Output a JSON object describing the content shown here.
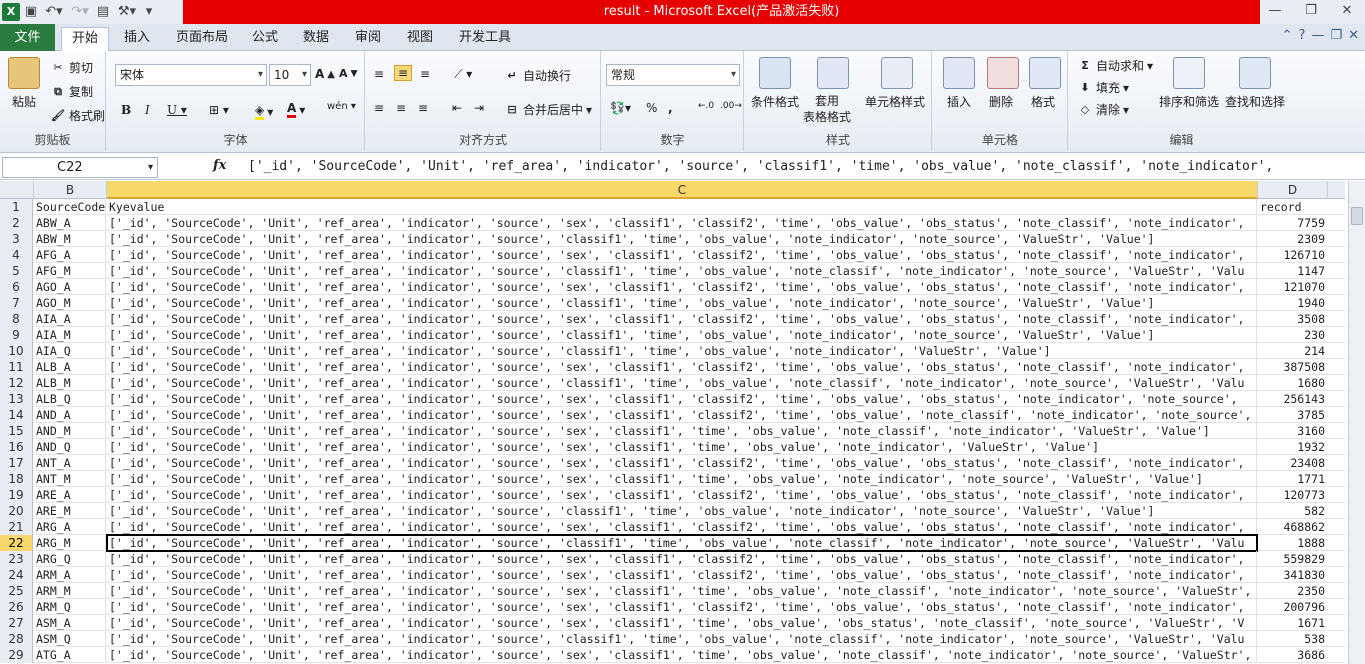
{
  "window": {
    "title": "result - Microsoft Excel(产品激活失败)"
  },
  "tabs": [
    "文件",
    "开始",
    "插入",
    "页面布局",
    "公式",
    "数据",
    "审阅",
    "视图",
    "开发工具"
  ],
  "ribbon": {
    "clipboard": {
      "label": "剪贴板",
      "paste": "粘贴",
      "cut": "剪切",
      "copy": "复制",
      "painter": "格式刷"
    },
    "font": {
      "label": "字体",
      "name": "宋体",
      "size": "10"
    },
    "align": {
      "label": "对齐方式",
      "wrap": "自动换行",
      "merge": "合并后居中"
    },
    "number": {
      "label": "数字",
      "format": "常规"
    },
    "styles": {
      "label": "样式",
      "cond": "条件格式",
      "table": "套用\n表格格式",
      "cell": "单元格样式"
    },
    "cells": {
      "label": "单元格",
      "insert": "插入",
      "delete": "删除",
      "format": "格式"
    },
    "edit": {
      "label": "编辑",
      "autosum": "自动求和",
      "fill": "填充",
      "clear": "清除",
      "sort": "排序和筛选",
      "find": "查找和选择"
    }
  },
  "formula_bar": {
    "name_box": "C22",
    "fx": "fx",
    "content": "['_id', 'SourceCode', 'Unit', 'ref_area', 'indicator', 'source', 'classif1', 'time', 'obs_value', 'note_classif', 'note_indicator',"
  },
  "columns": [
    "B",
    "C",
    "D"
  ],
  "rows": [
    {
      "n": "1",
      "b": "SourceCode",
      "c": "Kyevalue",
      "d": "record",
      "num": false
    },
    {
      "n": "2",
      "b": "ABW_A",
      "c": "['_id', 'SourceCode', 'Unit', 'ref_area', 'indicator', 'source', 'sex', 'classif1', 'classif2', 'time', 'obs_value', 'obs_status', 'note_classif', 'note_indicator',",
      "d": "7759"
    },
    {
      "n": "3",
      "b": "ABW_M",
      "c": "['_id', 'SourceCode', 'Unit', 'ref_area', 'indicator', 'source', 'classif1', 'time', 'obs_value', 'note_indicator', 'note_source', 'ValueStr', 'Value']",
      "d": "2309"
    },
    {
      "n": "4",
      "b": "AFG_A",
      "c": "['_id', 'SourceCode', 'Unit', 'ref_area', 'indicator', 'source', 'sex', 'classif1', 'classif2', 'time', 'obs_value', 'obs_status', 'note_classif', 'note_indicator',",
      "d": "126710"
    },
    {
      "n": "5",
      "b": "AFG_M",
      "c": "['_id', 'SourceCode', 'Unit', 'ref_area', 'indicator', 'source', 'classif1', 'time', 'obs_value', 'note_classif', 'note_indicator', 'note_source', 'ValueStr', 'Valu",
      "d": "1147"
    },
    {
      "n": "6",
      "b": "AGO_A",
      "c": "['_id', 'SourceCode', 'Unit', 'ref_area', 'indicator', 'source', 'sex', 'classif1', 'classif2', 'time', 'obs_value', 'obs_status', 'note_classif', 'note_indicator',",
      "d": "121070"
    },
    {
      "n": "7",
      "b": "AGO_M",
      "c": "['_id', 'SourceCode', 'Unit', 'ref_area', 'indicator', 'source', 'classif1', 'time', 'obs_value', 'note_indicator', 'note_source', 'ValueStr', 'Value']",
      "d": "1940"
    },
    {
      "n": "8",
      "b": "AIA_A",
      "c": "['_id', 'SourceCode', 'Unit', 'ref_area', 'indicator', 'source', 'sex', 'classif1', 'classif2', 'time', 'obs_value', 'obs_status', 'note_classif', 'note_indicator',",
      "d": "3508"
    },
    {
      "n": "9",
      "b": "AIA_M",
      "c": "['_id', 'SourceCode', 'Unit', 'ref_area', 'indicator', 'source', 'classif1', 'time', 'obs_value', 'note_indicator', 'note_source', 'ValueStr', 'Value']",
      "d": "230"
    },
    {
      "n": "10",
      "b": "AIA_Q",
      "c": "['_id', 'SourceCode', 'Unit', 'ref_area', 'indicator', 'source', 'classif1', 'time', 'obs_value', 'note_indicator', 'ValueStr', 'Value']",
      "d": "214"
    },
    {
      "n": "11",
      "b": "ALB_A",
      "c": "['_id', 'SourceCode', 'Unit', 'ref_area', 'indicator', 'source', 'sex', 'classif1', 'classif2', 'time', 'obs_value', 'obs_status', 'note_classif', 'note_indicator',",
      "d": "387508"
    },
    {
      "n": "12",
      "b": "ALB_M",
      "c": "['_id', 'SourceCode', 'Unit', 'ref_area', 'indicator', 'source', 'classif1', 'time', 'obs_value', 'note_classif', 'note_indicator', 'note_source', 'ValueStr', 'Valu",
      "d": "1680"
    },
    {
      "n": "13",
      "b": "ALB_Q",
      "c": "['_id', 'SourceCode', 'Unit', 'ref_area', 'indicator', 'source', 'sex', 'classif1', 'classif2', 'time', 'obs_value', 'obs_status', 'note_indicator', 'note_source',",
      "d": "256143"
    },
    {
      "n": "14",
      "b": "AND_A",
      "c": "['_id', 'SourceCode', 'Unit', 'ref_area', 'indicator', 'source', 'sex', 'classif1', 'classif2', 'time', 'obs_value', 'note_classif', 'note_indicator', 'note_source',",
      "d": "3785"
    },
    {
      "n": "15",
      "b": "AND_M",
      "c": "['_id', 'SourceCode', 'Unit', 'ref_area', 'indicator', 'source', 'sex', 'classif1', 'time', 'obs_value', 'note_classif', 'note_indicator', 'ValueStr', 'Value']",
      "d": "3160"
    },
    {
      "n": "16",
      "b": "AND_Q",
      "c": "['_id', 'SourceCode', 'Unit', 'ref_area', 'indicator', 'source', 'sex', 'classif1', 'time', 'obs_value', 'note_indicator', 'ValueStr', 'Value']",
      "d": "1932"
    },
    {
      "n": "17",
      "b": "ANT_A",
      "c": "['_id', 'SourceCode', 'Unit', 'ref_area', 'indicator', 'source', 'sex', 'classif1', 'classif2', 'time', 'obs_value', 'obs_status', 'note_classif', 'note_indicator',",
      "d": "23408"
    },
    {
      "n": "18",
      "b": "ANT_M",
      "c": "['_id', 'SourceCode', 'Unit', 'ref_area', 'indicator', 'source', 'sex', 'classif1', 'time', 'obs_value', 'note_indicator', 'note_source', 'ValueStr', 'Value']",
      "d": "1771"
    },
    {
      "n": "19",
      "b": "ARE_A",
      "c": "['_id', 'SourceCode', 'Unit', 'ref_area', 'indicator', 'source', 'sex', 'classif1', 'classif2', 'time', 'obs_value', 'obs_status', 'note_classif', 'note_indicator',",
      "d": "120773"
    },
    {
      "n": "20",
      "b": "ARE_M",
      "c": "['_id', 'SourceCode', 'Unit', 'ref_area', 'indicator', 'source', 'classif1', 'time', 'obs_value', 'note_indicator', 'note_source', 'ValueStr', 'Value']",
      "d": "582"
    },
    {
      "n": "21",
      "b": "ARG_A",
      "c": "['_id', 'SourceCode', 'Unit', 'ref_area', 'indicator', 'source', 'sex', 'classif1', 'classif2', 'time', 'obs_value', 'obs_status', 'note_classif', 'note_indicator',",
      "d": "468862"
    },
    {
      "n": "22",
      "b": "ARG_M",
      "c": "['_id', 'SourceCode', 'Unit', 'ref_area', 'indicator', 'source', 'classif1', 'time', 'obs_value', 'note_classif', 'note_indicator', 'note_source', 'ValueStr', 'Valu",
      "d": "1888",
      "selected": true
    },
    {
      "n": "23",
      "b": "ARG_Q",
      "c": "['_id', 'SourceCode', 'Unit', 'ref_area', 'indicator', 'source', 'sex', 'classif1', 'classif2', 'time', 'obs_value', 'obs_status', 'note_classif', 'note_indicator',",
      "d": "559829"
    },
    {
      "n": "24",
      "b": "ARM_A",
      "c": "['_id', 'SourceCode', 'Unit', 'ref_area', 'indicator', 'source', 'sex', 'classif1', 'classif2', 'time', 'obs_value', 'obs_status', 'note_classif', 'note_indicator',",
      "d": "341830"
    },
    {
      "n": "25",
      "b": "ARM_M",
      "c": "['_id', 'SourceCode', 'Unit', 'ref_area', 'indicator', 'source', 'sex', 'classif1', 'time', 'obs_value', 'note_classif', 'note_indicator', 'note_source', 'ValueStr',",
      "d": "2350"
    },
    {
      "n": "26",
      "b": "ARM_Q",
      "c": "['_id', 'SourceCode', 'Unit', 'ref_area', 'indicator', 'source', 'sex', 'classif1', 'classif2', 'time', 'obs_value', 'obs_status', 'note_classif', 'note_indicator',",
      "d": "200796"
    },
    {
      "n": "27",
      "b": "ASM_A",
      "c": "['_id', 'SourceCode', 'Unit', 'ref_area', 'indicator', 'source', 'sex', 'classif1', 'time', 'obs_value', 'obs_status', 'note_classif', 'note_source', 'ValueStr', 'V",
      "d": "1671"
    },
    {
      "n": "28",
      "b": "ASM_Q",
      "c": "['_id', 'SourceCode', 'Unit', 'ref_area', 'indicator', 'source', 'classif1', 'time', 'obs_value', 'note_classif', 'note_indicator', 'note_source', 'ValueStr', 'Valu",
      "d": "538"
    },
    {
      "n": "29",
      "b": "ATG_A",
      "c": "['_id', 'SourceCode', 'Unit', 'ref_area', 'indicator', 'source', 'sex', 'classif1', 'time', 'obs_value', 'note_classif', 'note_indicator', 'note_source', 'ValueStr',",
      "d": "3686"
    }
  ]
}
